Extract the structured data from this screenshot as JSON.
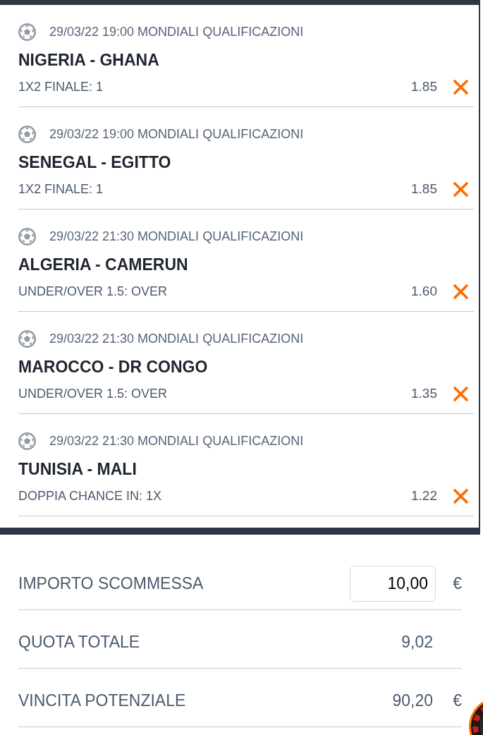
{
  "bets": [
    {
      "event_info": "29/03/22 19:00 MONDIALI QUALIFICAZIONI",
      "match": "NIGERIA - GHANA",
      "selection": "1X2 FINALE: 1",
      "odds": "1.85"
    },
    {
      "event_info": "29/03/22 19:00 MONDIALI QUALIFICAZIONI",
      "match": "SENEGAL - EGITTO",
      "selection": "1X2 FINALE: 1",
      "odds": "1.85"
    },
    {
      "event_info": "29/03/22 21:30 MONDIALI QUALIFICAZIONI",
      "match": "ALGERIA - CAMERUN",
      "selection": "UNDER/OVER 1.5: OVER",
      "odds": "1.60"
    },
    {
      "event_info": "29/03/22 21:30 MONDIALI QUALIFICAZIONI",
      "match": "MAROCCO - DR CONGO",
      "selection": "UNDER/OVER 1.5: OVER",
      "odds": "1.35"
    },
    {
      "event_info": "29/03/22 21:30 MONDIALI QUALIFICAZIONI",
      "match": "TUNISIA - MALI",
      "selection": "DOPPIA CHANCE IN: 1X",
      "odds": "1.22"
    }
  ],
  "summary": [
    {
      "kind": "input",
      "label": "IMPORTO SCOMMESSA",
      "value": "10,00",
      "currency": "€"
    },
    {
      "kind": "text",
      "label": "QUOTA TOTALE",
      "value": "9,02"
    },
    {
      "kind": "text",
      "label": "VINCITA POTENZIALE",
      "value": "90,20",
      "currency": "€"
    }
  ]
}
